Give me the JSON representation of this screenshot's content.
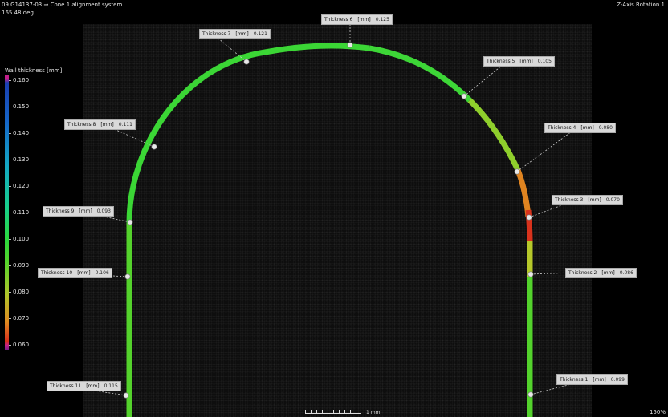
{
  "header": {
    "title": "09 G14137-03 ⇒ Cone 1 alignment system",
    "angle": "165.48 deg",
    "view_mode": "Z-Axis Rotation 1"
  },
  "legend": {
    "title": "Wall thickness [mm]",
    "ticks": [
      "0.160",
      "0.150",
      "0.140",
      "0.130",
      "0.120",
      "0.110",
      "0.100",
      "0.090",
      "0.080",
      "0.070",
      "0.060"
    ],
    "colors": {
      "high": "#1a3fb0",
      "mid": "#2bd83c",
      "low": "#d82d1c",
      "out_of_range": "#c41f8b"
    }
  },
  "measurements": [
    {
      "label": "Thickness 1",
      "unit": "[mm]",
      "value": "0.099"
    },
    {
      "label": "Thickness 2",
      "unit": "[mm]",
      "value": "0.086"
    },
    {
      "label": "Thickness 3",
      "unit": "[mm]",
      "value": "0.070"
    },
    {
      "label": "Thickness 4",
      "unit": "[mm]",
      "value": "0.080"
    },
    {
      "label": "Thickness 5",
      "unit": "[mm]",
      "value": "0.105"
    },
    {
      "label": "Thickness 6",
      "unit": "[mm]",
      "value": "0.125"
    },
    {
      "label": "Thickness 7",
      "unit": "[mm]",
      "value": "0.121"
    },
    {
      "label": "Thickness 8",
      "unit": "[mm]",
      "value": "0.111"
    },
    {
      "label": "Thickness 9",
      "unit": "[mm]",
      "value": "0.093"
    },
    {
      "label": "Thickness 10",
      "unit": "[mm]",
      "value": "0.106"
    },
    {
      "label": "Thickness 11",
      "unit": "[mm]",
      "value": "0.115"
    }
  ],
  "scale": {
    "label": "1 mm"
  },
  "zoom": "150%"
}
